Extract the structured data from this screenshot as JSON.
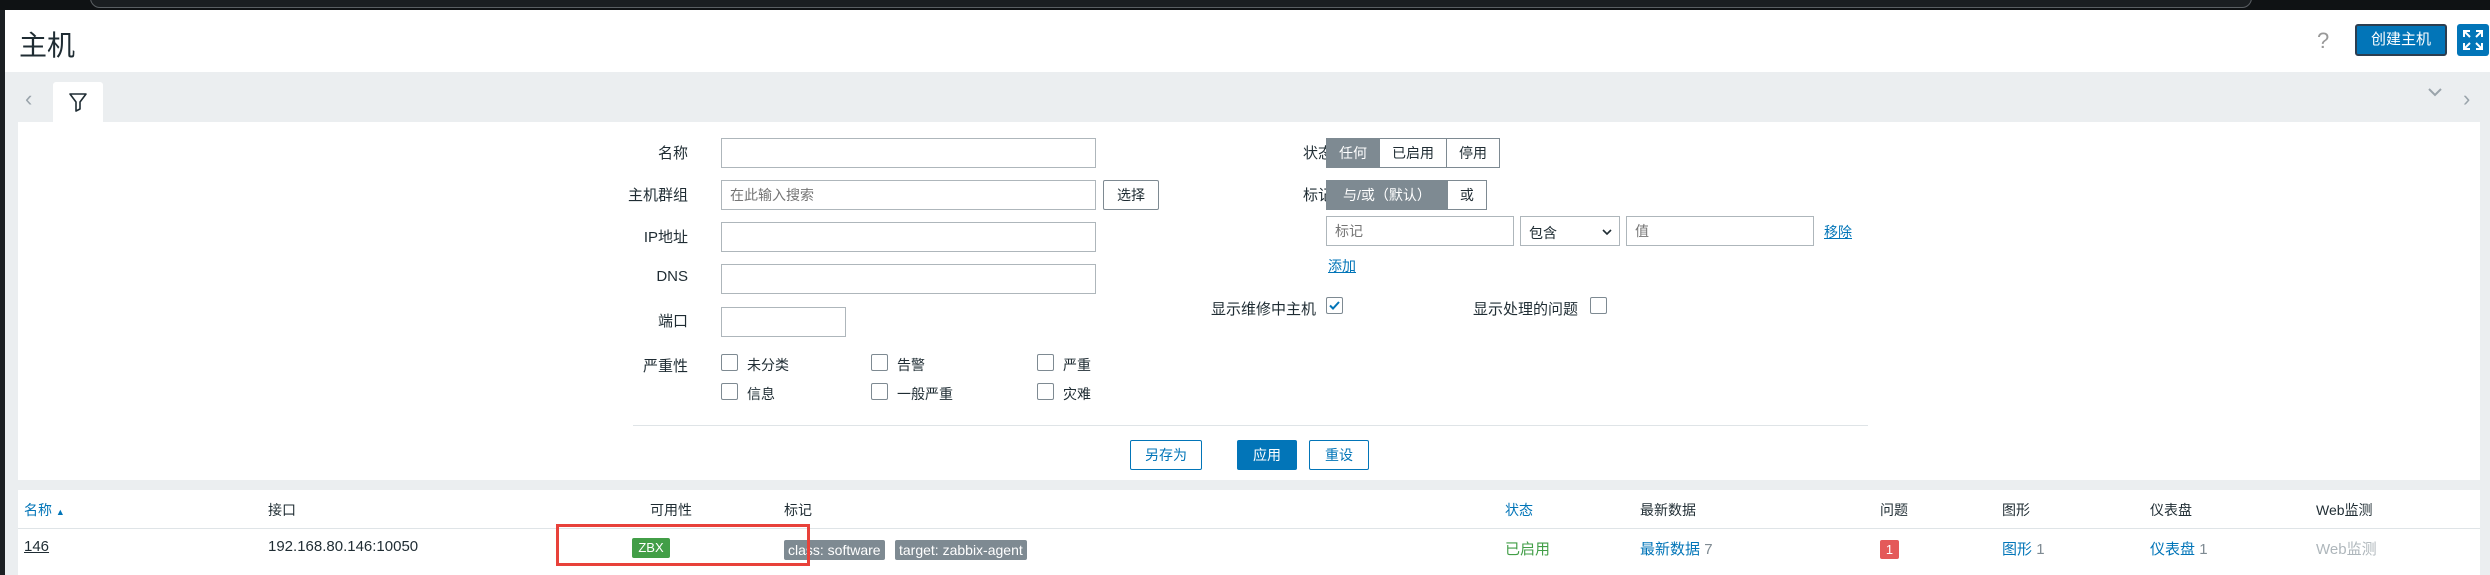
{
  "page": {
    "title": "主机",
    "help_icon": "?",
    "create_host_label": "创建主机"
  },
  "tabs": {
    "filter_icon": "filter-icon"
  },
  "filter": {
    "name_label": "名称",
    "name_value": "",
    "hostgroup_label": "主机群组",
    "hostgroup_placeholder": "在此输入搜索",
    "select_label": "选择",
    "ip_label": "IP地址",
    "dns_label": "DNS",
    "port_label": "端口",
    "severity_label": "严重性",
    "severities": [
      "未分类",
      "告警",
      "严重",
      "信息",
      "一般严重",
      "灾难"
    ],
    "status_label": "状态",
    "status_options": [
      "任何",
      "已启用",
      "停用"
    ],
    "status_selected": "任何",
    "tags_label": "标记",
    "tag_mode_options": [
      "与/或（默认）",
      "或"
    ],
    "tag_mode_selected": "与/或（默认）",
    "tag_name_placeholder": "标记",
    "tag_operator": "包含",
    "tag_value_placeholder": "值",
    "remove_label": "移除",
    "add_label": "添加",
    "show_maintenance_label": "显示维修中主机",
    "show_maintenance_checked": true,
    "show_suppressed_label": "显示处理的问题",
    "show_suppressed_checked": false,
    "save_as_label": "另存为",
    "apply_label": "应用",
    "reset_label": "重设"
  },
  "table": {
    "headers": {
      "name": "名称",
      "sort_indicator": "▲",
      "interface": "接口",
      "availability": "可用性",
      "tags": "标记",
      "status": "状态",
      "latest_data": "最新数据",
      "problems": "问题",
      "graphs": "图形",
      "dashboards": "仪表盘",
      "web": "Web监测"
    },
    "rows": [
      {
        "name": "146",
        "interface": "192.168.80.146:10050",
        "availability": "ZBX",
        "tags": [
          "class: software",
          "target: zabbix-agent"
        ],
        "status": "已启用",
        "latest_data": "最新数据",
        "latest_data_count": "7",
        "problems": "1",
        "graphs": "图形",
        "graphs_count": "1",
        "dashboards": "仪表盘",
        "dashboards_count": "1",
        "web": "Web监测"
      }
    ]
  },
  "colors": {
    "primary": "#0275b8",
    "enabled_green": "#429e47",
    "problem_red": "#e45959",
    "highlight_red": "#e8413a"
  }
}
